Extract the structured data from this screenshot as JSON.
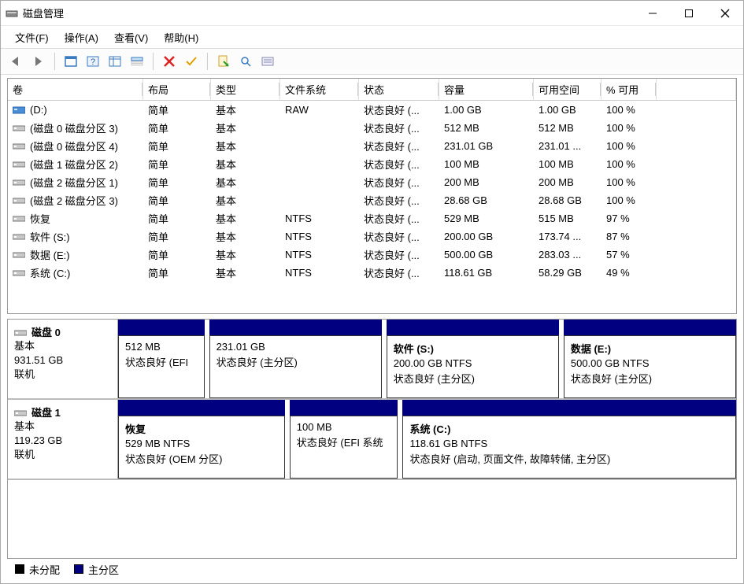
{
  "title": "磁盘管理",
  "menu": {
    "file": "文件(F)",
    "action": "操作(A)",
    "view": "查看(V)",
    "help": "帮助(H)"
  },
  "columns": {
    "volume": "卷",
    "layout": "布局",
    "type": "类型",
    "fs": "文件系统",
    "status": "状态",
    "capacity": "容量",
    "free": "可用空间",
    "pct": "% 可用"
  },
  "volumes": [
    {
      "name": "(D:)",
      "layout": "简单",
      "type": "基本",
      "fs": "RAW",
      "status": "状态良好 (...",
      "capacity": "1.00 GB",
      "free": "1.00 GB",
      "pct": "100 %",
      "icon": "drive-blue"
    },
    {
      "name": "(磁盘 0 磁盘分区 3)",
      "layout": "简单",
      "type": "基本",
      "fs": "",
      "status": "状态良好 (...",
      "capacity": "512 MB",
      "free": "512 MB",
      "pct": "100 %",
      "icon": "drive"
    },
    {
      "name": "(磁盘 0 磁盘分区 4)",
      "layout": "简单",
      "type": "基本",
      "fs": "",
      "status": "状态良好 (...",
      "capacity": "231.01 GB",
      "free": "231.01 ...",
      "pct": "100 %",
      "icon": "drive"
    },
    {
      "name": "(磁盘 1 磁盘分区 2)",
      "layout": "简单",
      "type": "基本",
      "fs": "",
      "status": "状态良好 (...",
      "capacity": "100 MB",
      "free": "100 MB",
      "pct": "100 %",
      "icon": "drive"
    },
    {
      "name": "(磁盘 2 磁盘分区 1)",
      "layout": "简单",
      "type": "基本",
      "fs": "",
      "status": "状态良好 (...",
      "capacity": "200 MB",
      "free": "200 MB",
      "pct": "100 %",
      "icon": "drive"
    },
    {
      "name": "(磁盘 2 磁盘分区 3)",
      "layout": "简单",
      "type": "基本",
      "fs": "",
      "status": "状态良好 (...",
      "capacity": "28.68 GB",
      "free": "28.68 GB",
      "pct": "100 %",
      "icon": "drive"
    },
    {
      "name": "恢复",
      "layout": "简单",
      "type": "基本",
      "fs": "NTFS",
      "status": "状态良好 (...",
      "capacity": "529 MB",
      "free": "515 MB",
      "pct": "97 %",
      "icon": "drive"
    },
    {
      "name": "软件 (S:)",
      "layout": "简单",
      "type": "基本",
      "fs": "NTFS",
      "status": "状态良好 (...",
      "capacity": "200.00 GB",
      "free": "173.74 ...",
      "pct": "87 %",
      "icon": "drive"
    },
    {
      "name": "数据 (E:)",
      "layout": "简单",
      "type": "基本",
      "fs": "NTFS",
      "status": "状态良好 (...",
      "capacity": "500.00 GB",
      "free": "283.03 ...",
      "pct": "57 %",
      "icon": "drive"
    },
    {
      "name": "系统 (C:)",
      "layout": "简单",
      "type": "基本",
      "fs": "NTFS",
      "status": "状态良好 (...",
      "capacity": "118.61 GB",
      "free": "58.29 GB",
      "pct": "49 %",
      "icon": "drive"
    }
  ],
  "disks": [
    {
      "name": "磁盘 0",
      "subtype": "基本",
      "size": "931.51 GB",
      "status": "联机",
      "parts": [
        {
          "title": "",
          "line1": "512 MB",
          "line2": "状态良好 (EFI",
          "flex": 1
        },
        {
          "title": "",
          "line1": "231.01 GB",
          "line2": "状态良好 (主分区)",
          "flex": 2
        },
        {
          "title": "软件  (S:)",
          "line1": "200.00 GB NTFS",
          "line2": "状态良好 (主分区)",
          "flex": 2
        },
        {
          "title": "数据   (E:)",
          "line1": "500.00 GB NTFS",
          "line2": "状态良好 (主分区)",
          "flex": 2
        }
      ]
    },
    {
      "name": "磁盘 1",
      "subtype": "基本",
      "size": "119.23 GB",
      "status": "联机",
      "parts": [
        {
          "title": "恢复",
          "line1": "529 MB NTFS",
          "line2": "状态良好 (OEM 分区)",
          "flex": 2
        },
        {
          "title": "",
          "line1": "100 MB",
          "line2": "状态良好 (EFI 系统",
          "flex": 1.3
        },
        {
          "title": "系统  (C:)",
          "line1": "118.61 GB NTFS",
          "line2": "状态良好 (启动, 页面文件, 故障转储, 主分区)",
          "flex": 4
        }
      ]
    }
  ],
  "legend": {
    "unallocated": "未分配",
    "primary": "主分区"
  }
}
